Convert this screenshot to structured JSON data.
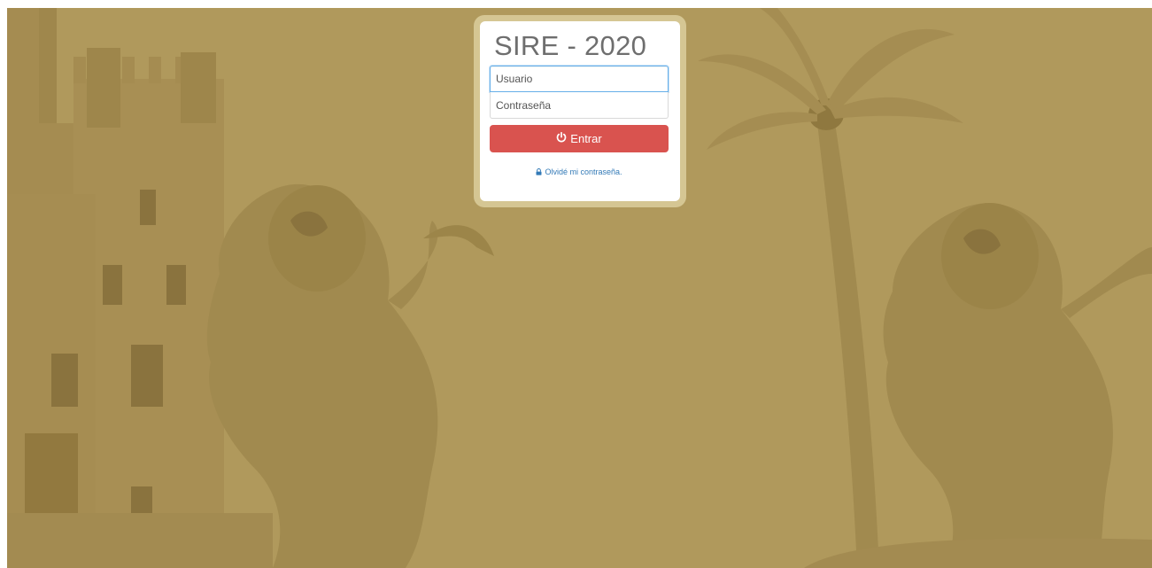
{
  "login": {
    "title": "SIRE - 2020",
    "username_placeholder": "Usuario",
    "username_value": "",
    "password_placeholder": "Contraseña",
    "password_value": "",
    "submit_label": "Entrar",
    "submit_icon": "power-icon",
    "forgot_label": "Olvidé mi contraseña.",
    "forgot_icon": "lock-icon"
  },
  "colors": {
    "background": "#b0995c",
    "card_border": "#d5c693",
    "button": "#d9534f",
    "link": "#337ab7",
    "focus": "#66afe9"
  }
}
